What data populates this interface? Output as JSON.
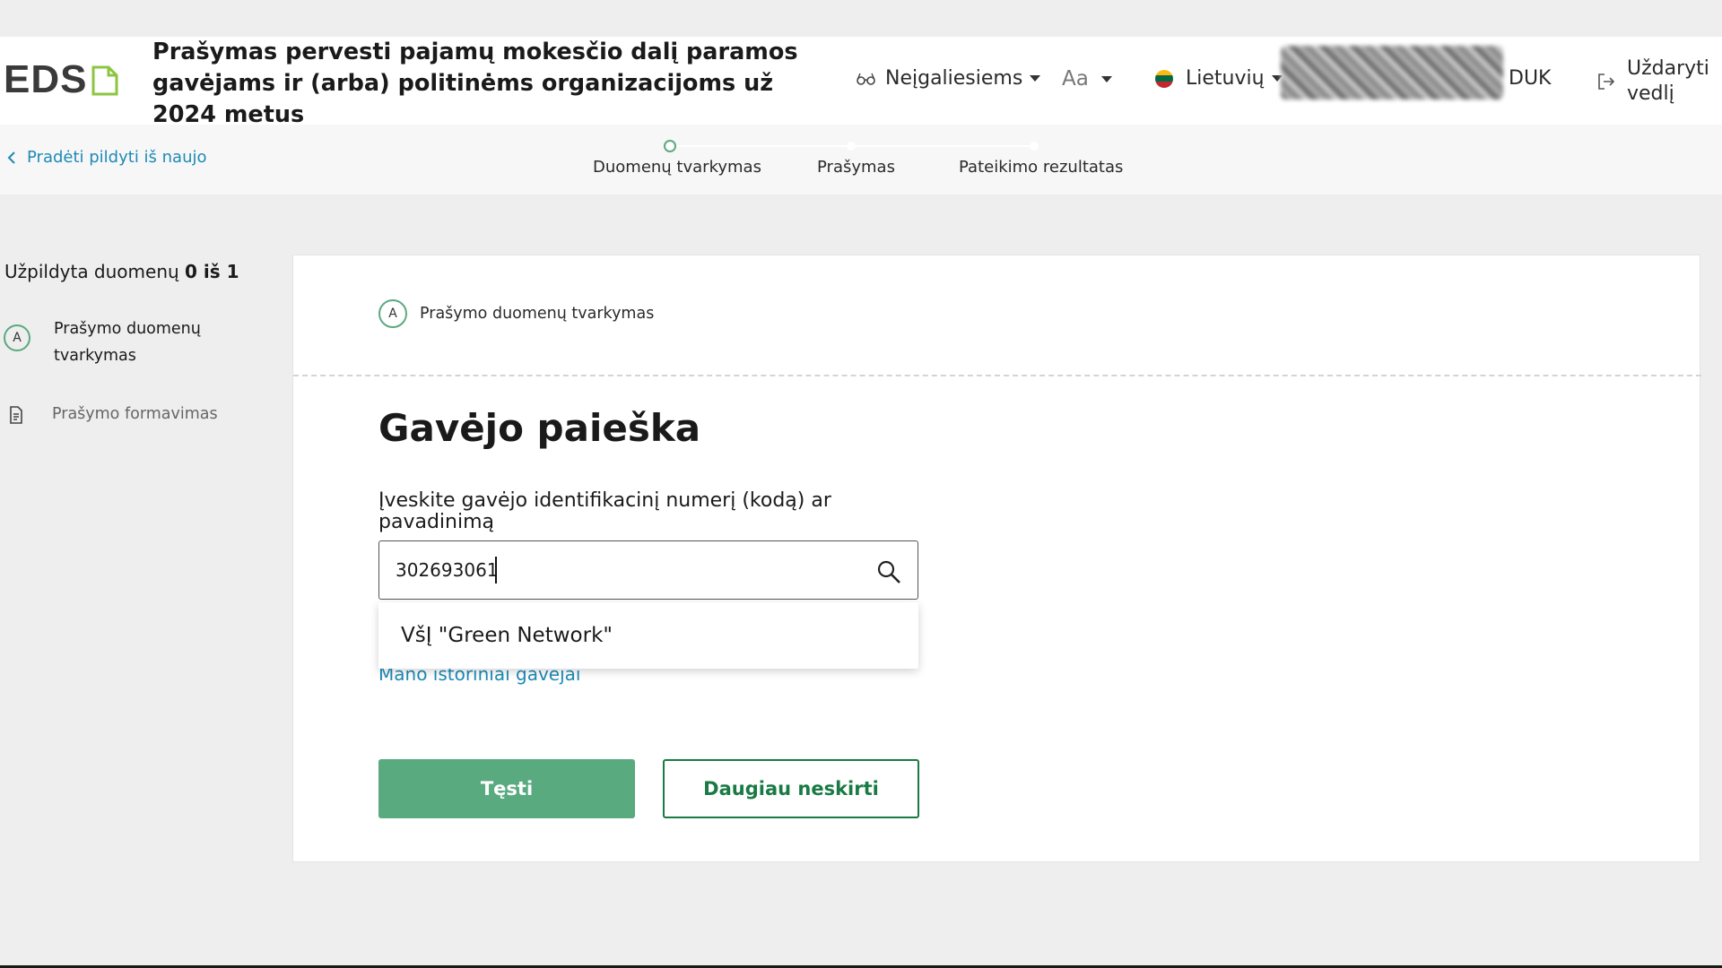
{
  "header": {
    "logo": "EDS",
    "title": "Prašymas pervesti pajamų mokesčio dalį paramos gavėjams ir (arba) politinėms organizacijoms už 2024 metus",
    "accessibility": "Neįgaliesiems",
    "font_size": "Aa",
    "language": "Lietuvių",
    "faq": "DUK",
    "close": "Uždaryti vedlį"
  },
  "steps": {
    "back": "Pradėti pildyti iš naujo",
    "items": [
      {
        "label": "Duomenų tvarkymas"
      },
      {
        "label": "Prašymas"
      },
      {
        "label": "Pateikimo rezultatas"
      }
    ]
  },
  "sidebar": {
    "progress_prefix": "Užpildyta duomenų",
    "progress_value": "0 iš 1",
    "items": [
      {
        "letter": "A",
        "label": "Prašymo duomenų tvarkymas"
      },
      {
        "label": "Prašymo formavimas"
      }
    ]
  },
  "main": {
    "section_letter": "A",
    "section_title": "Prašymo duomenų tvarkymas",
    "heading": "Gavėjo paieška",
    "field_label": "Įveskite gavėjo identifikacinį numerį (kodą) ar pavadinimą",
    "search_value": "302693061",
    "suggestion": "VšĮ \"Green Network\"",
    "history_link": "Mano istoriniai gavėjai",
    "continue": "Tęsti",
    "no_more": "Daugiau neskirti"
  },
  "colors": {
    "accent": "#5aaa80",
    "link": "#1e8ab6",
    "outline": "#1a7a45"
  },
  "icons": [
    "glasses-icon",
    "close-exit-icon",
    "chevron-left-icon",
    "document-icon",
    "search-icon"
  ]
}
